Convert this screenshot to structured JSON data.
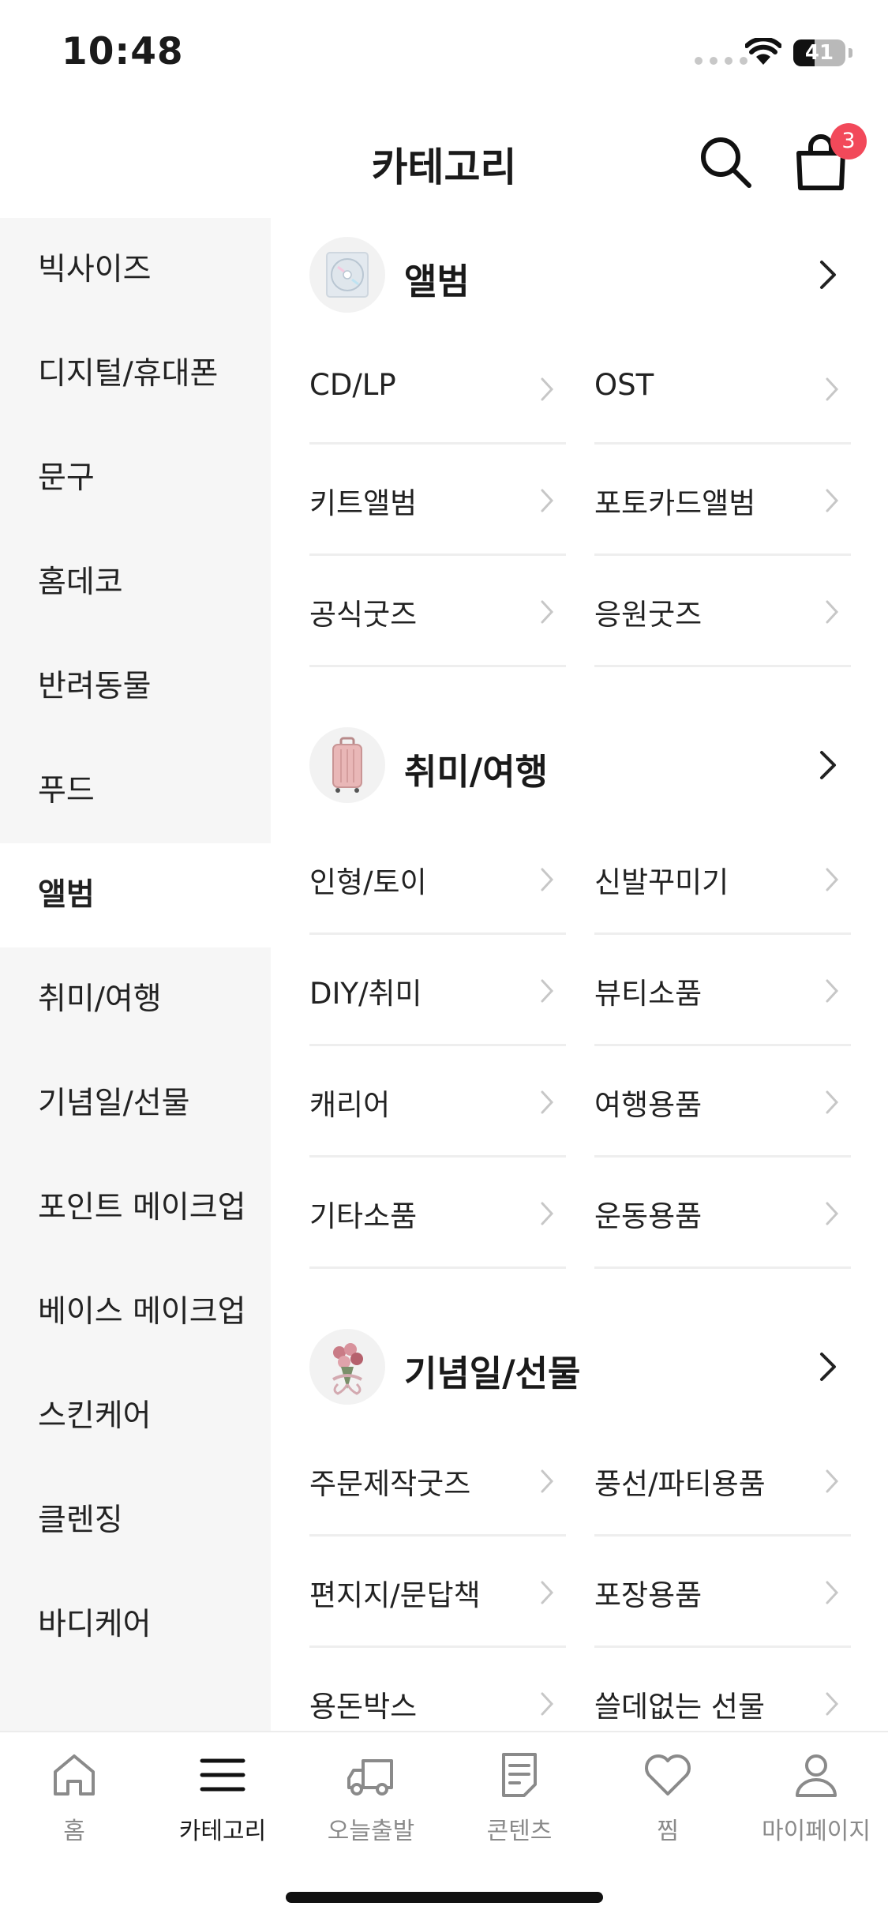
{
  "status_bar": {
    "time": "10:48",
    "battery": "41",
    "battery_percent": 41
  },
  "header": {
    "title": "카테고리",
    "cart_count": "3"
  },
  "sidebar": {
    "items": [
      {
        "label": "빅사이즈",
        "active": false
      },
      {
        "label": "디지털/휴대폰",
        "active": false
      },
      {
        "label": "문구",
        "active": false
      },
      {
        "label": "홈데코",
        "active": false
      },
      {
        "label": "반려동물",
        "active": false
      },
      {
        "label": "푸드",
        "active": false
      },
      {
        "label": "앨범",
        "active": true
      },
      {
        "label": "취미/여행",
        "active": false
      },
      {
        "label": "기념일/선물",
        "active": false
      },
      {
        "label": "포인트 메이크업",
        "active": false
      },
      {
        "label": "베이스 메이크업",
        "active": false
      },
      {
        "label": "스킨케어",
        "active": false
      },
      {
        "label": "클렌징",
        "active": false
      },
      {
        "label": "바디케어",
        "active": false
      }
    ]
  },
  "sections": [
    {
      "title": "앨범",
      "icon": "album-cd-icon",
      "items": [
        "CD/LP",
        "OST",
        "키트앨범",
        "포토카드앨범",
        "공식굿즈",
        "응원굿즈"
      ]
    },
    {
      "title": "취미/여행",
      "icon": "suitcase-icon",
      "items": [
        "인형/토이",
        "신발꾸미기",
        "DIY/취미",
        "뷰티소품",
        "캐리어",
        "여행용품",
        "기타소품",
        "운동용품"
      ]
    },
    {
      "title": "기념일/선물",
      "icon": "bouquet-icon",
      "items": [
        "주문제작굿즈",
        "풍선/파티용품",
        "편지지/문답책",
        "포장용품",
        "용돈박스",
        "쓸데없는 선물"
      ]
    }
  ],
  "bottom_nav": {
    "items": [
      {
        "label": "홈",
        "icon": "home-icon",
        "active": false
      },
      {
        "label": "카테고리",
        "icon": "menu-icon",
        "active": true
      },
      {
        "label": "오늘출발",
        "icon": "truck-icon",
        "active": false
      },
      {
        "label": "콘텐츠",
        "icon": "document-icon",
        "active": false
      },
      {
        "label": "찜",
        "icon": "heart-icon",
        "active": false
      },
      {
        "label": "마이페이지",
        "icon": "user-icon",
        "active": false
      }
    ]
  },
  "colors": {
    "accent_badge": "#f2495a",
    "sidebar_bg": "#f6f6f6",
    "divider": "#eeeeee",
    "inactive_text": "#8a8a8a"
  }
}
